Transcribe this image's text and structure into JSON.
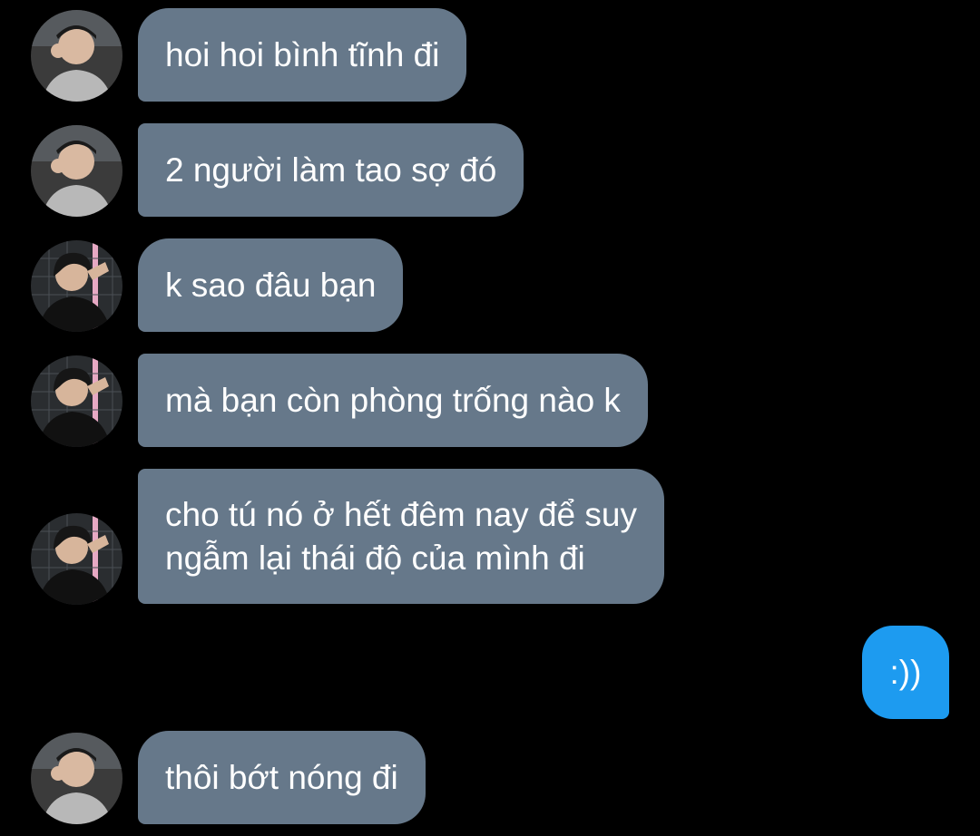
{
  "conversation": {
    "messages": [
      {
        "text": "hoi hoi bình tĩnh đi",
        "sender": "other",
        "avatar": "avatar-a"
      },
      {
        "text": "2 người làm tao sợ đó",
        "sender": "other",
        "avatar": "avatar-a"
      },
      {
        "text": "k sao đâu bạn",
        "sender": "other",
        "avatar": "avatar-b"
      },
      {
        "text": "mà bạn còn phòng trống nào k",
        "sender": "other",
        "avatar": "avatar-b"
      },
      {
        "text": "cho tú nó ở hết đêm nay để suy\nngẫm lại thái độ của mình đi",
        "sender": "other",
        "avatar": "avatar-b"
      },
      {
        "text": ":))",
        "sender": "me"
      },
      {
        "text": "thôi bớt nóng đi",
        "sender": "other",
        "avatar": "avatar-a"
      }
    ]
  },
  "colors": {
    "background": "#000000",
    "incoming_bubble": "#66788a",
    "outgoing_bubble": "#1d9bf0",
    "text": "#ffffff"
  }
}
